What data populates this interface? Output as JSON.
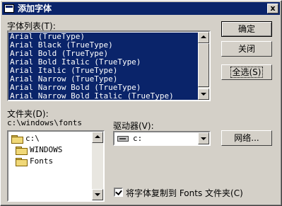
{
  "titlebar": {
    "title": "添加字体",
    "close_symbol": "x"
  },
  "font_list": {
    "label": "字体列表(T):",
    "items": [
      "Arial (TrueType)",
      "Arial Black (TrueType)",
      "Arial Bold (TrueType)",
      "Arial Bold Italic (TrueType)",
      "Arial Italic (TrueType)",
      "Arial Narrow (TrueType)",
      "Arial Narrow Bold (TrueType)",
      "Arial Narrow Bold Italic (TrueType)"
    ]
  },
  "buttons": {
    "ok": "确定",
    "close": "关闭",
    "select_all": "全选(S)",
    "network": "网络..."
  },
  "folders": {
    "label": "文件夹(D):",
    "path": "c:\\windows\\fonts",
    "tree": [
      {
        "name": "c:\\",
        "icon": "open-folder-icon"
      },
      {
        "name": "WINDOWS",
        "icon": "open-folder-icon"
      },
      {
        "name": "Fonts",
        "icon": "open-folder-icon"
      }
    ]
  },
  "drives": {
    "label": "驱动器(V):",
    "value": "c:",
    "icon": "drive-icon"
  },
  "copy_option": {
    "label": "将字体复制到 Fonts 文件夹(C)",
    "checked": true
  },
  "colors": {
    "selection": "#0a246a",
    "face": "#d4d0c8",
    "title": "#0a246a"
  }
}
